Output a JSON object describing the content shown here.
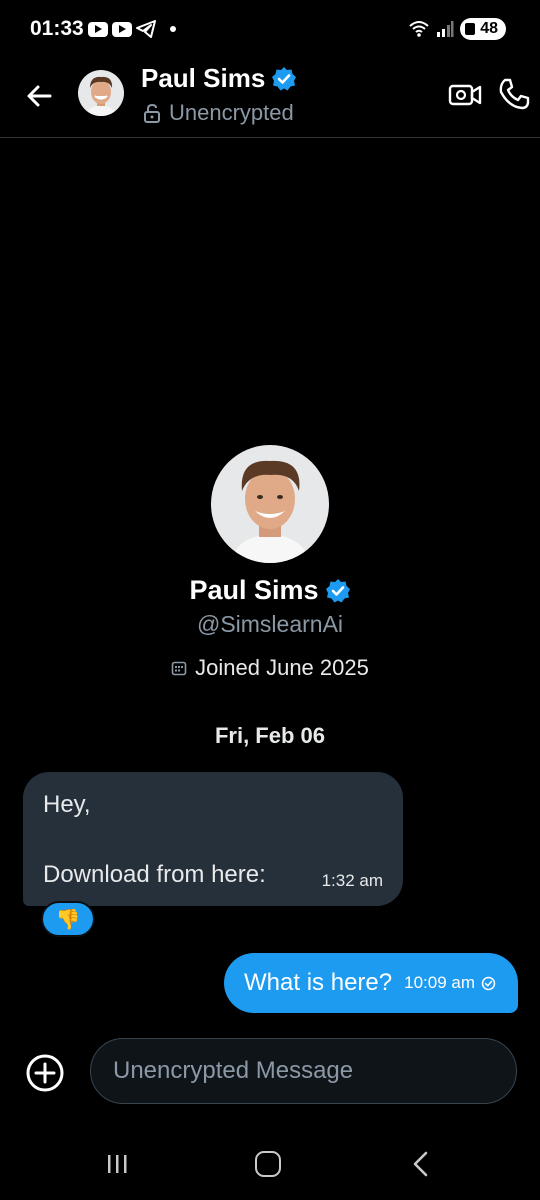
{
  "status_bar": {
    "time": "01:33",
    "battery": "48"
  },
  "header": {
    "name": "Paul Sims",
    "encryption_status": "Unencrypted",
    "back_icon": "arrow-left-icon",
    "video_icon": "video-call-icon",
    "phone_icon": "phone-icon"
  },
  "profile": {
    "name": "Paul Sims",
    "handle": "@SimslearnAi",
    "joined": "Joined June 2025"
  },
  "date_separator": "Fri, Feb 06",
  "messages": [
    {
      "direction": "incoming",
      "line1": "Hey,",
      "line2": "Download from here:",
      "time": "1:32 am",
      "reaction": "👎"
    },
    {
      "direction": "outgoing",
      "text": "What is here?",
      "time": "10:09 am"
    }
  ],
  "composer": {
    "placeholder": "Unencrypted Message"
  },
  "colors": {
    "accent": "#1d9bf0",
    "incoming_bubble": "#25303a",
    "background": "#000000",
    "muted_text": "#8b98a5"
  }
}
